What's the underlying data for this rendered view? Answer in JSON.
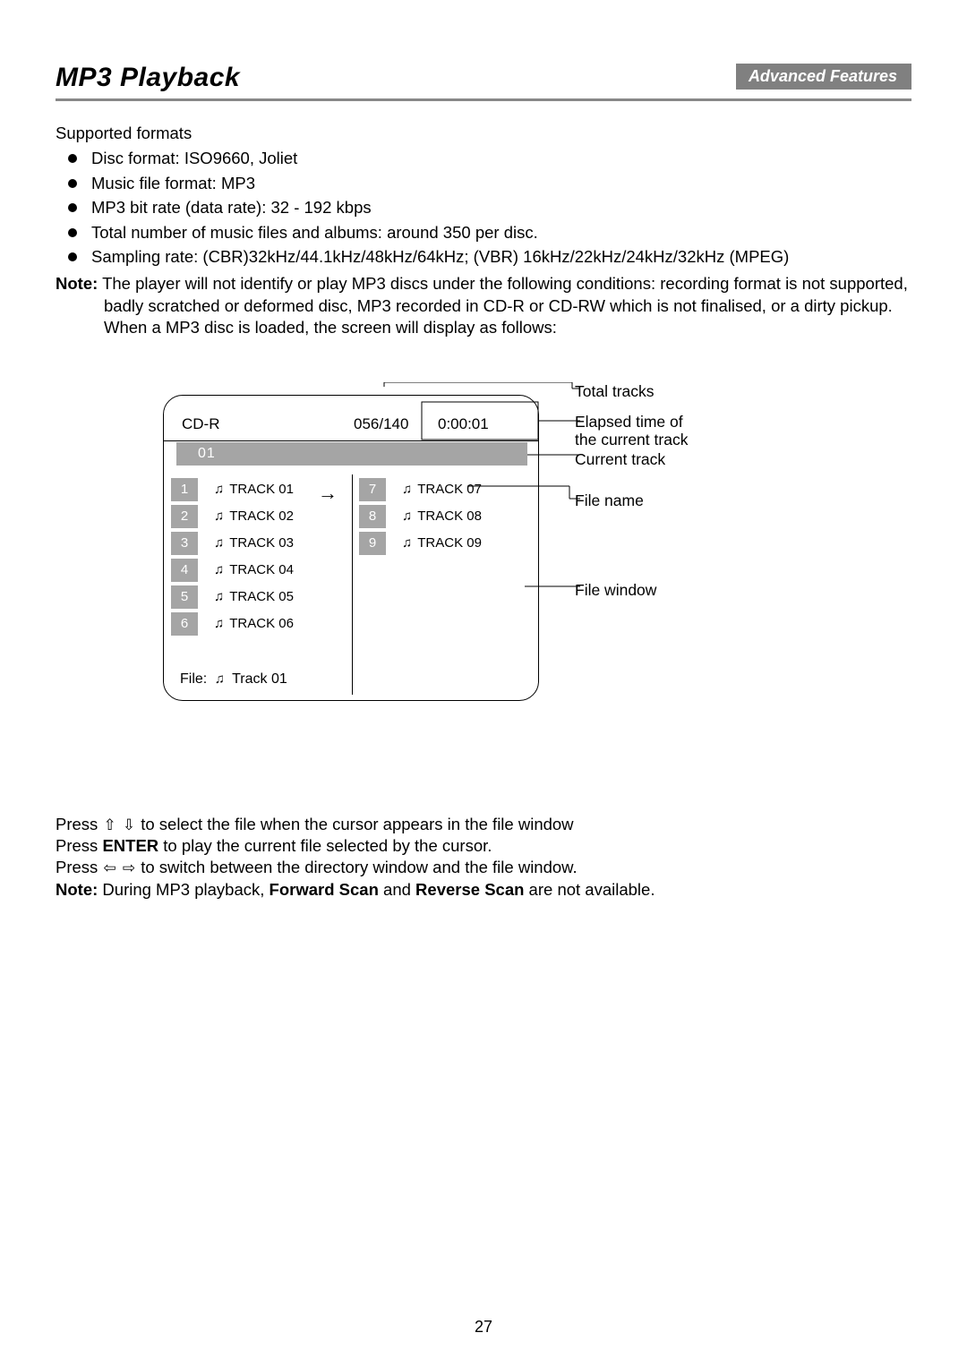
{
  "header": {
    "title": "MP3 Playback",
    "section_label": "Advanced Features"
  },
  "supported": {
    "heading": "Supported formats",
    "items": [
      "Disc format: ISO9660, Joliet",
      "Music file format: MP3",
      "MP3 bit rate (data rate): 32 - 192 kbps",
      "Total number of music files and albums: around 350 per disc.",
      "Sampling rate: (CBR)32kHz/44.1kHz/48kHz/64kHz; (VBR) 16kHz/22kHz/24kHz/32kHz (MPEG)"
    ]
  },
  "note_main": {
    "label": "Note:",
    "line1": "The player will not identify or play MP3 discs under the following conditions: recording format is not supported,",
    "line2": "badly scratched or deformed disc, MP3 recorded in CD-R or CD-RW which is not finalised, or a dirty pickup.",
    "line3": "When a MP3 disc is loaded, the screen will display as follows:"
  },
  "osd": {
    "disc_type": "CD-R",
    "counter": "056/140",
    "elapsed": "0:00:01",
    "current_dir": "01",
    "tracks_left": [
      {
        "n": "1",
        "name": "TRACK 01"
      },
      {
        "n": "2",
        "name": "TRACK 02"
      },
      {
        "n": "3",
        "name": "TRACK 03"
      },
      {
        "n": "4",
        "name": "TRACK 04"
      },
      {
        "n": "5",
        "name": "TRACK 05"
      },
      {
        "n": "6",
        "name": "TRACK 06"
      }
    ],
    "tracks_right": [
      {
        "n": "7",
        "name": "TRACK 07"
      },
      {
        "n": "8",
        "name": "TRACK 08"
      },
      {
        "n": "9",
        "name": "TRACK 09"
      }
    ],
    "file_prefix": "File:",
    "file_name": "Track 01"
  },
  "callouts": {
    "total_tracks": "Total tracks",
    "elapsed_1": "Elapsed time of",
    "elapsed_2": "the current track",
    "current_track": "Current track",
    "file_name": "File name",
    "file_window": "File window"
  },
  "instructions": {
    "l1a": "Press ",
    "l1b": " to select the file when the cursor appears in the file window",
    "l2a": "Press ",
    "enter": "ENTER",
    "l2b": " to play the current file selected by the cursor.",
    "l3a": "Press ",
    "l3b": " to switch between the directory window and the file window.",
    "l4label": "Note:",
    "l4a": " During MP3 playback, ",
    "fwd": "Forward Scan",
    "l4b": " and ",
    "rev": "Reverse Scan",
    "l4c": " are not available."
  },
  "page_number": "27",
  "glyphs": {
    "note": "♫",
    "up": "⇧",
    "down": "⇩",
    "left": "⇦",
    "right": "⇨",
    "arrow": "→"
  }
}
